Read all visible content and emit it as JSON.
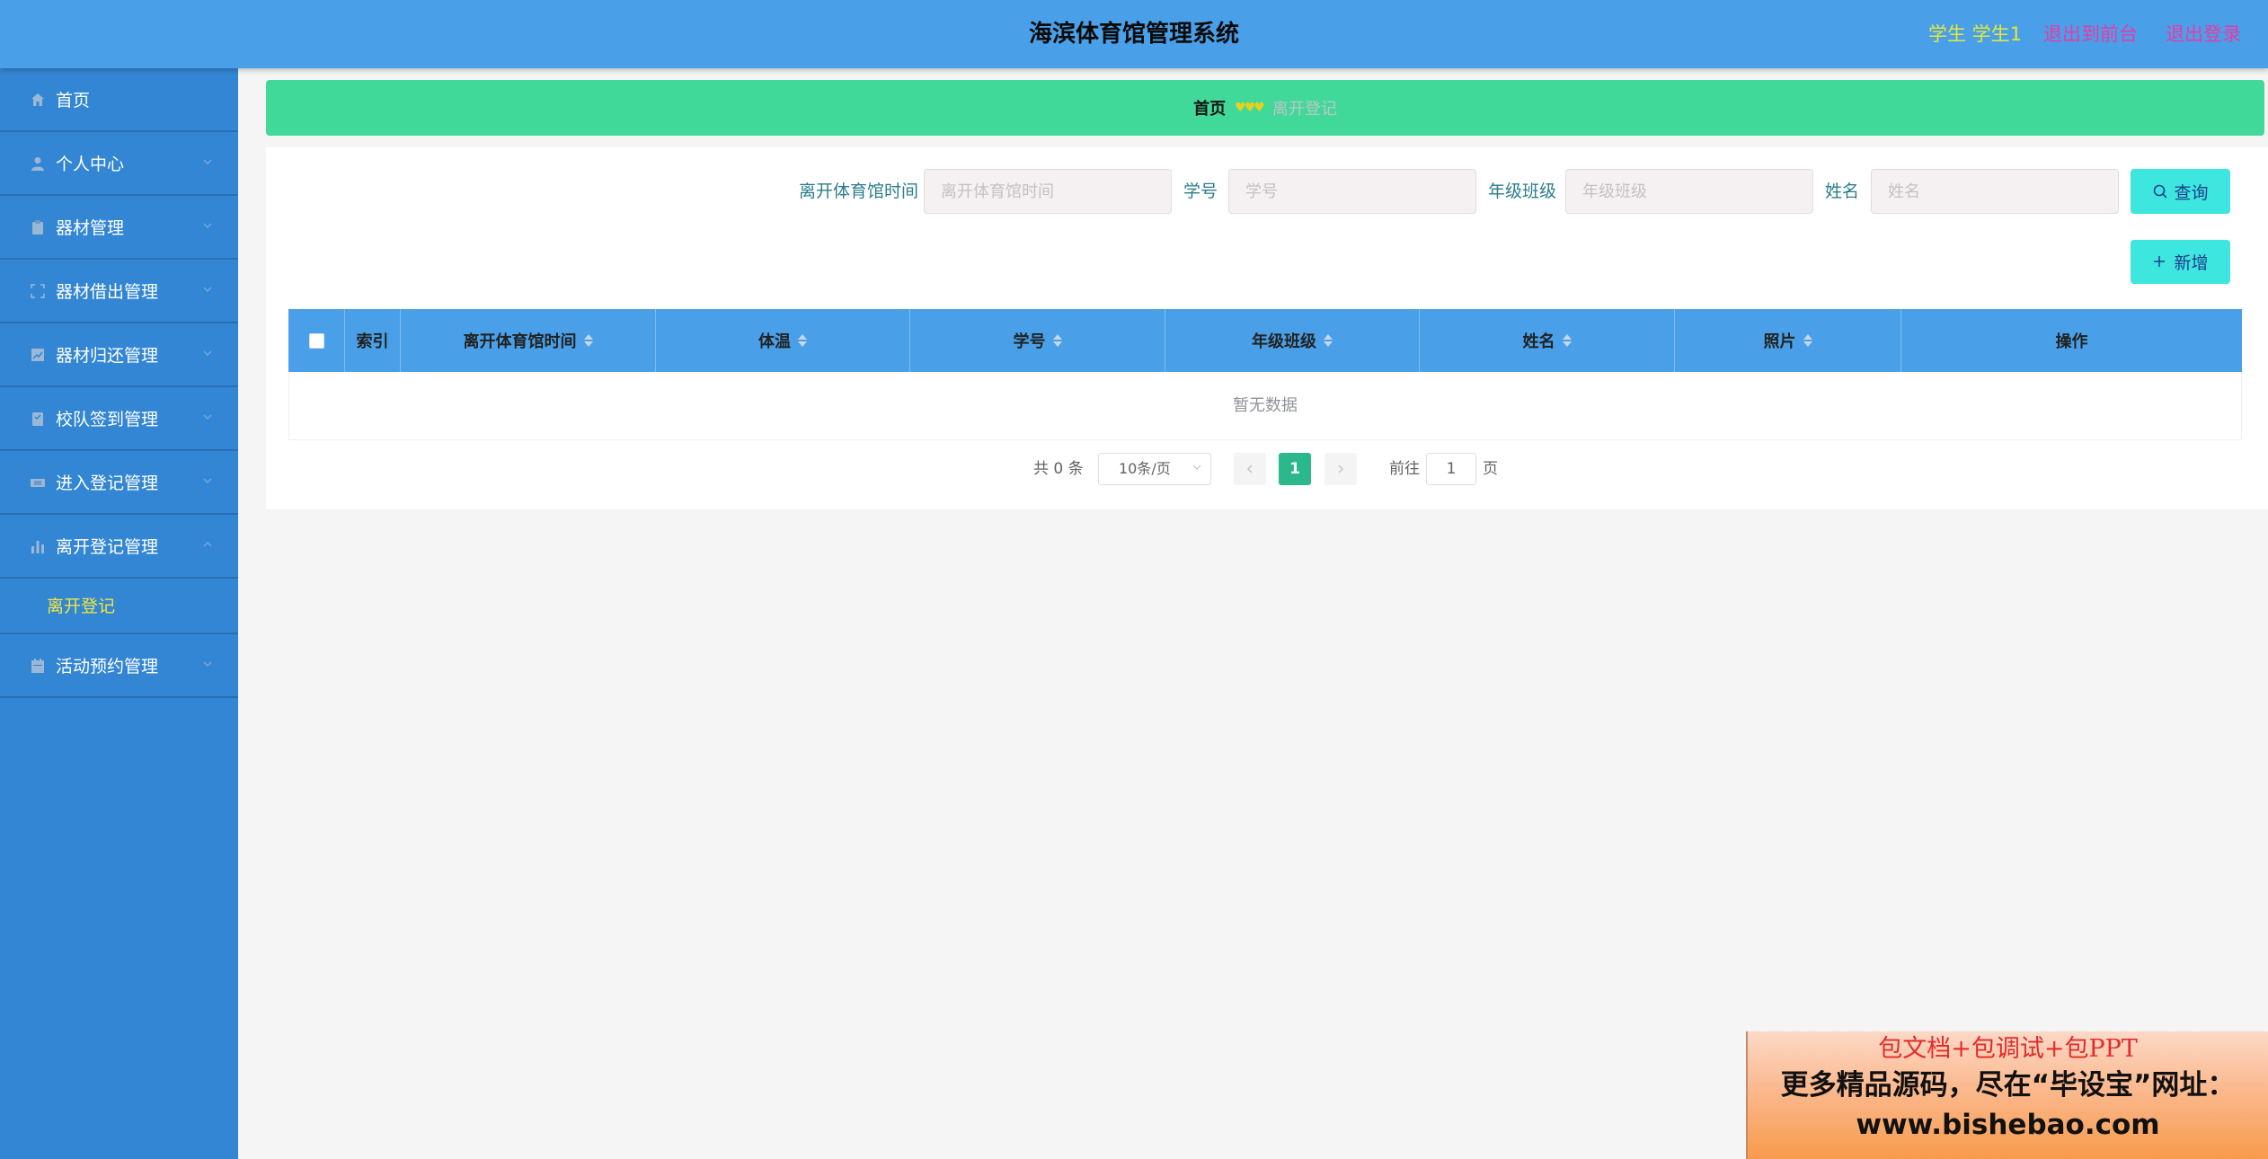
{
  "header": {
    "title": "海滨体育馆管理系统",
    "user": "学生 学生1",
    "to_front": "退出到前台",
    "logout": "退出登录"
  },
  "sidebar": {
    "items": [
      {
        "label": "首页",
        "icon": "home-icon"
      },
      {
        "label": "个人中心",
        "icon": "user-icon"
      },
      {
        "label": "器材管理",
        "icon": "clipboard-icon"
      },
      {
        "label": "器材借出管理",
        "icon": "fullscreen-icon"
      },
      {
        "label": "器材归还管理",
        "icon": "chart-icon"
      },
      {
        "label": "校队签到管理",
        "icon": "checklist-icon"
      },
      {
        "label": "进入登记管理",
        "icon": "ticket-icon"
      },
      {
        "label": "离开登记管理",
        "icon": "bar-chart-icon"
      },
      {
        "label": "活动预约管理",
        "icon": "calendar-icon"
      }
    ],
    "submenu": {
      "label": "离开登记"
    }
  },
  "breadcrumb": {
    "home": "首页",
    "separator": "♥♥♥",
    "current": "离开登记"
  },
  "search": {
    "fields": [
      {
        "label": "离开体育馆时间",
        "placeholder": "离开体育馆时间"
      },
      {
        "label": "学号",
        "placeholder": "学号"
      },
      {
        "label": "年级班级",
        "placeholder": "年级班级"
      },
      {
        "label": "姓名",
        "placeholder": "姓名"
      }
    ],
    "query_label": "查询",
    "add_label": "新增"
  },
  "table": {
    "columns": [
      "索引",
      "离开体育馆时间",
      "体温",
      "学号",
      "年级班级",
      "姓名",
      "照片",
      "操作"
    ],
    "empty_text": "暂无数据"
  },
  "pagination": {
    "total": "共 0 条",
    "page_size": "10条/页",
    "current_page": "1",
    "goto_label": "前往",
    "goto_value": "1",
    "page_unit": "页"
  },
  "ad": {
    "line1": "包文档+包调试+包PPT",
    "line2": "更多精品源码，尽在“毕设宝”网址：",
    "line3": "www.bishebao.com"
  },
  "colors": {
    "header": "#4aa0e8",
    "sidebar": "#3386d3",
    "breadcrumb": "#41d99a",
    "button": "#3ee6e0",
    "active_page": "#2bb98b"
  }
}
